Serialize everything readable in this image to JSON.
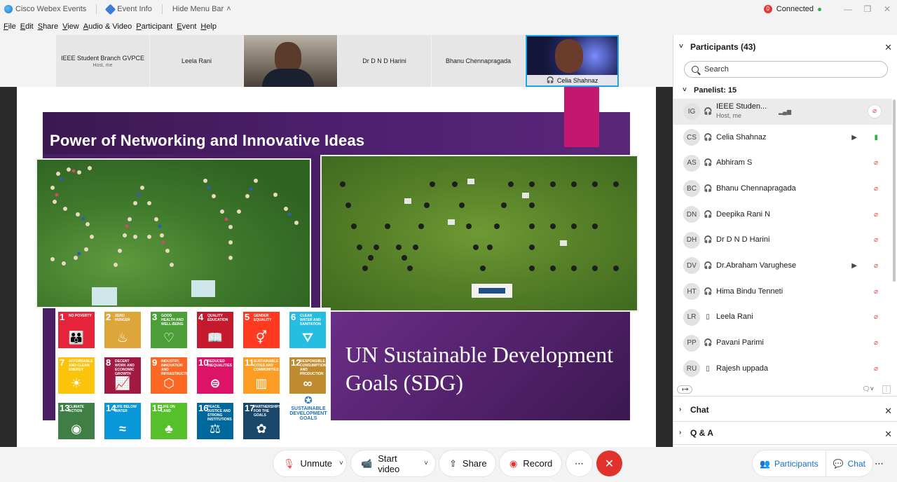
{
  "titlebar": {
    "app_name": "Cisco Webex Events",
    "event_info": "Event Info",
    "hide_menu": "Hide Menu Bar",
    "connection_count": "0",
    "connection_status": "Connected"
  },
  "menubar": [
    "File",
    "Edit",
    "Share",
    "View",
    "Audio & Video",
    "Participant",
    "Event",
    "Help"
  ],
  "thumbnails": [
    {
      "name": "IEEE Student Branch GVPCE",
      "sub": "Host, me"
    },
    {
      "name": "Leela Rani",
      "sub": ""
    },
    {
      "name": "",
      "sub": ""
    },
    {
      "name": "Dr D N D Harini",
      "sub": ""
    },
    {
      "name": "Bhanu Chennapragada",
      "sub": ""
    },
    {
      "name": "Celia Shahnaz",
      "sub": ""
    }
  ],
  "slide": {
    "title": "Power of Networking and Innovative Ideas",
    "sdg_heading": "UN Sustainable Development Goals (SDG)",
    "sdg_tiles": [
      {
        "num": "1",
        "name": "NO POVERTY",
        "color": "#e5243b",
        "glyph": "👪"
      },
      {
        "num": "2",
        "name": "ZERO HUNGER",
        "color": "#dda63a",
        "glyph": "♨"
      },
      {
        "num": "3",
        "name": "GOOD HEALTH AND WELL-BEING",
        "color": "#4c9f38",
        "glyph": "♡"
      },
      {
        "num": "4",
        "name": "QUALITY EDUCATION",
        "color": "#c5192d",
        "glyph": "📖"
      },
      {
        "num": "5",
        "name": "GENDER EQUALITY",
        "color": "#ff3a21",
        "glyph": "⚥"
      },
      {
        "num": "6",
        "name": "CLEAN WATER AND SANITATION",
        "color": "#26bde2",
        "glyph": "⛛"
      },
      {
        "num": "7",
        "name": "AFFORDABLE AND CLEAN ENERGY",
        "color": "#fcc30b",
        "glyph": "☀"
      },
      {
        "num": "8",
        "name": "DECENT WORK AND ECONOMIC GROWTH",
        "color": "#a21942",
        "glyph": "📈"
      },
      {
        "num": "9",
        "name": "INDUSTRY, INNOVATION AND INFRASTRUCTURE",
        "color": "#fd6925",
        "glyph": "⬡"
      },
      {
        "num": "10",
        "name": "REDUCED INEQUALITIES",
        "color": "#dd1367",
        "glyph": "⊜"
      },
      {
        "num": "11",
        "name": "SUSTAINABLE CITIES AND COMMUNITIES",
        "color": "#fd9d24",
        "glyph": "▥"
      },
      {
        "num": "12",
        "name": "RESPONSIBLE CONSUMPTION AND PRODUCTION",
        "color": "#bf8b2e",
        "glyph": "∞"
      },
      {
        "num": "13",
        "name": "CLIMATE ACTION",
        "color": "#3f7e44",
        "glyph": "◉"
      },
      {
        "num": "14",
        "name": "LIFE BELOW WATER",
        "color": "#0a97d9",
        "glyph": "≈"
      },
      {
        "num": "15",
        "name": "LIFE ON LAND",
        "color": "#56c02b",
        "glyph": "♣"
      },
      {
        "num": "16",
        "name": "PEACE, JUSTICE AND STRONG INSTITUTIONS",
        "color": "#00689d",
        "glyph": "⚖"
      },
      {
        "num": "17",
        "name": "PARTNERSHIPS FOR THE GOALS",
        "color": "#19486a",
        "glyph": "✿"
      }
    ],
    "sdg_logo": "SUSTAINABLE DEVELOPMENT GOALS"
  },
  "panel": {
    "title": "Participants (43)",
    "search_placeholder": "Search",
    "panelist_header": "Panelist: 15",
    "participants": [
      {
        "initials": "IG",
        "name": "IEEE Studen...",
        "sub": "Host, me",
        "device": "headset",
        "video": false,
        "mic": "muted",
        "selected": true
      },
      {
        "initials": "CS",
        "name": "Celia Shahnaz",
        "sub": "",
        "device": "headset",
        "video": true,
        "mic": "on",
        "selected": false
      },
      {
        "initials": "AS",
        "name": "Abhiram S",
        "sub": "",
        "device": "headset",
        "video": false,
        "mic": "muted",
        "selected": false
      },
      {
        "initials": "BC",
        "name": "Bhanu Chennapragada",
        "sub": "",
        "device": "headset",
        "video": false,
        "mic": "muted",
        "selected": false
      },
      {
        "initials": "DN",
        "name": "Deepika Rani N",
        "sub": "",
        "device": "headset",
        "video": false,
        "mic": "muted",
        "selected": false
      },
      {
        "initials": "DH",
        "name": "Dr D N D Harini",
        "sub": "",
        "device": "headset",
        "video": false,
        "mic": "muted",
        "selected": false
      },
      {
        "initials": "DV",
        "name": "Dr.Abraham Varughese",
        "sub": "",
        "device": "headset",
        "video": true,
        "mic": "muted",
        "selected": false
      },
      {
        "initials": "HT",
        "name": "Hima Bindu Tenneti",
        "sub": "",
        "device": "headset",
        "video": false,
        "mic": "muted",
        "selected": false
      },
      {
        "initials": "LR",
        "name": "Leela Rani",
        "sub": "",
        "device": "phone",
        "video": false,
        "mic": "muted",
        "selected": false
      },
      {
        "initials": "PP",
        "name": "Pavani Parimi",
        "sub": "",
        "device": "headset",
        "video": false,
        "mic": "muted",
        "selected": false
      },
      {
        "initials": "RU",
        "name": "Rajesh uppada",
        "sub": "",
        "device": "phone",
        "video": false,
        "mic": "muted",
        "selected": false
      }
    ],
    "chat_title": "Chat",
    "qa_title": "Q & A"
  },
  "toolbar": {
    "unmute": "Unmute",
    "start_video": "Start video",
    "share": "Share",
    "record": "Record",
    "participants": "Participants",
    "chat": "Chat"
  }
}
